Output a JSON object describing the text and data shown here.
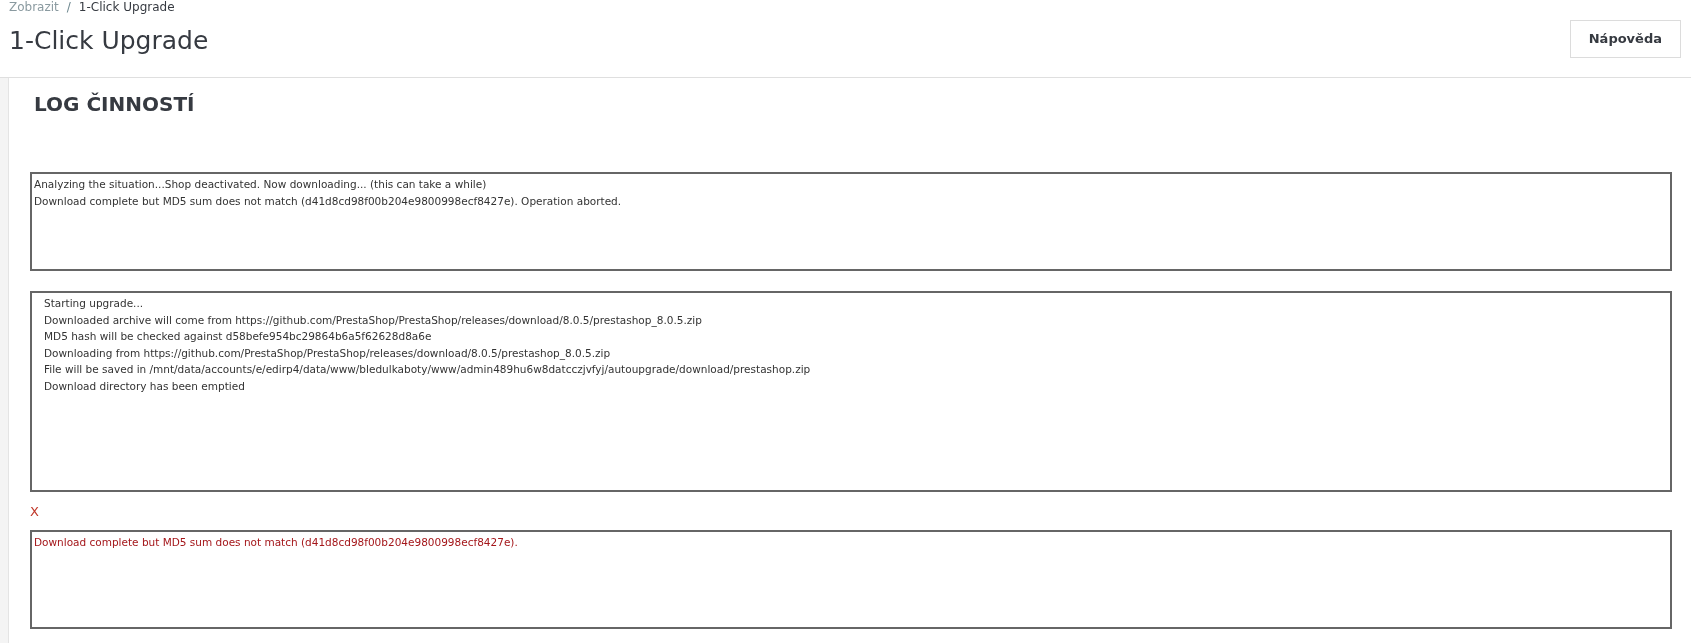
{
  "breadcrumb": [
    {
      "label": "Zobrazit",
      "current": false
    },
    {
      "label": "1-Click Upgrade",
      "current": true
    }
  ],
  "breadcrumb_separator": "/",
  "page_title": "1-Click Upgrade",
  "help_button": "Nápověda",
  "section_title": "LOG ČINNOSTÍ",
  "log_panels": [
    {
      "kind": "info",
      "lines": [
        "Analyzing the situation...Shop deactivated. Now downloading... (this can take a while)",
        "Download complete but MD5 sum does not match (d41d8cd98f00b204e9800998ecf8427e). Operation aborted."
      ]
    },
    {
      "kind": "steps",
      "lines": [
        "Starting upgrade...",
        "Downloaded archive will come from https://github.com/PrestaShop/PrestaShop/releases/download/8.0.5/prestashop_8.0.5.zip",
        "MD5 hash will be checked against d58befe954bc29864b6a5f62628d8a6e",
        "Downloading from https://github.com/PrestaShop/PrestaShop/releases/download/8.0.5/prestashop_8.0.5.zip",
        "File will be saved in /mnt/data/accounts/e/edirp4/data/www/bledulkaboty/www/admin489hu6w8datcczjvfyj/autoupgrade/download/prestashop.zip",
        "Download directory has been emptied"
      ]
    },
    {
      "kind": "error",
      "label": "X",
      "lines": [
        "Download complete but MD5 sum does not match (d41d8cd98f00b204e9800998ecf8427e)."
      ]
    }
  ]
}
